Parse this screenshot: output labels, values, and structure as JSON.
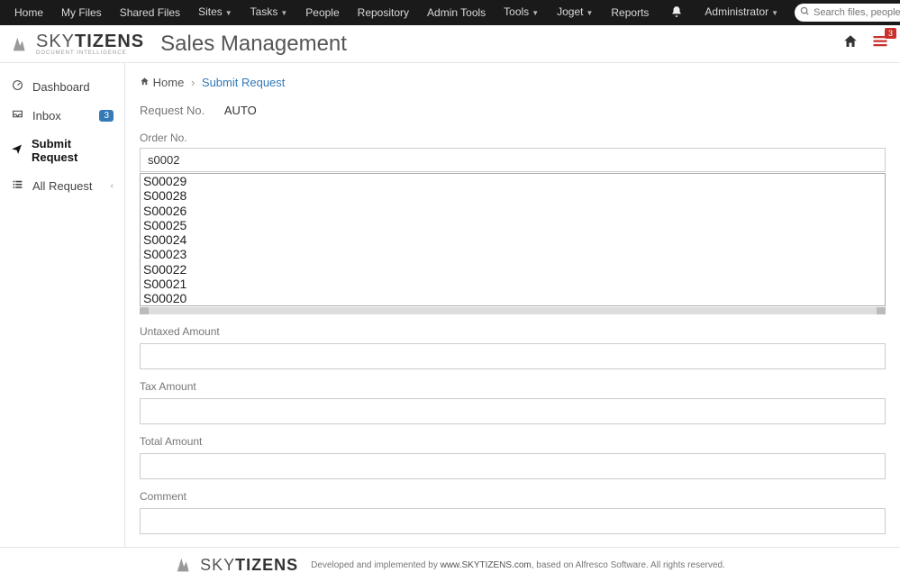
{
  "topnav": {
    "items": [
      {
        "label": "Home",
        "dd": false
      },
      {
        "label": "My Files",
        "dd": false
      },
      {
        "label": "Shared Files",
        "dd": false
      },
      {
        "label": "Sites",
        "dd": true
      },
      {
        "label": "Tasks",
        "dd": true
      },
      {
        "label": "People",
        "dd": false
      },
      {
        "label": "Repository",
        "dd": false
      },
      {
        "label": "Admin Tools",
        "dd": false
      },
      {
        "label": "Tools",
        "dd": true
      },
      {
        "label": "Joget",
        "dd": true
      },
      {
        "label": "Reports",
        "dd": false
      }
    ],
    "admin_label": "Administrator",
    "search_placeholder": "Search files, people, sites"
  },
  "header": {
    "brand_a": "SKY",
    "brand_b": "TIZENS",
    "brand_sub": "DOCUMENT INTELLIGENCE",
    "page_title": "Sales Management",
    "task_badge": "3"
  },
  "sidebar": {
    "items": [
      {
        "icon": "dashboard-icon",
        "label": "Dashboard"
      },
      {
        "icon": "inbox-icon",
        "label": "Inbox",
        "badge": "3"
      },
      {
        "icon": "send-icon",
        "label": "Submit Request",
        "active": true
      },
      {
        "icon": "list-icon",
        "label": "All Request",
        "chevron": true
      }
    ]
  },
  "breadcrumb": {
    "home": "Home",
    "current": "Submit Request"
  },
  "form": {
    "request_no_label": "Request No.",
    "request_no_value": "AUTO",
    "order_no_label": "Order No.",
    "order_no_value": "s0002",
    "order_options": [
      "S00029",
      "S00028",
      "S00026",
      "S00025",
      "S00024",
      "S00023",
      "S00022",
      "S00021",
      "S00020"
    ],
    "untaxed_label": "Untaxed Amount",
    "tax_label": "Tax Amount",
    "total_label": "Total Amount",
    "comment_label": "Comment"
  },
  "footer": {
    "text_a": "Developed and implemented by ",
    "link": "www.SKYTIZENS.com",
    "text_b": ", based on Alfresco Software. All rights reserved."
  }
}
